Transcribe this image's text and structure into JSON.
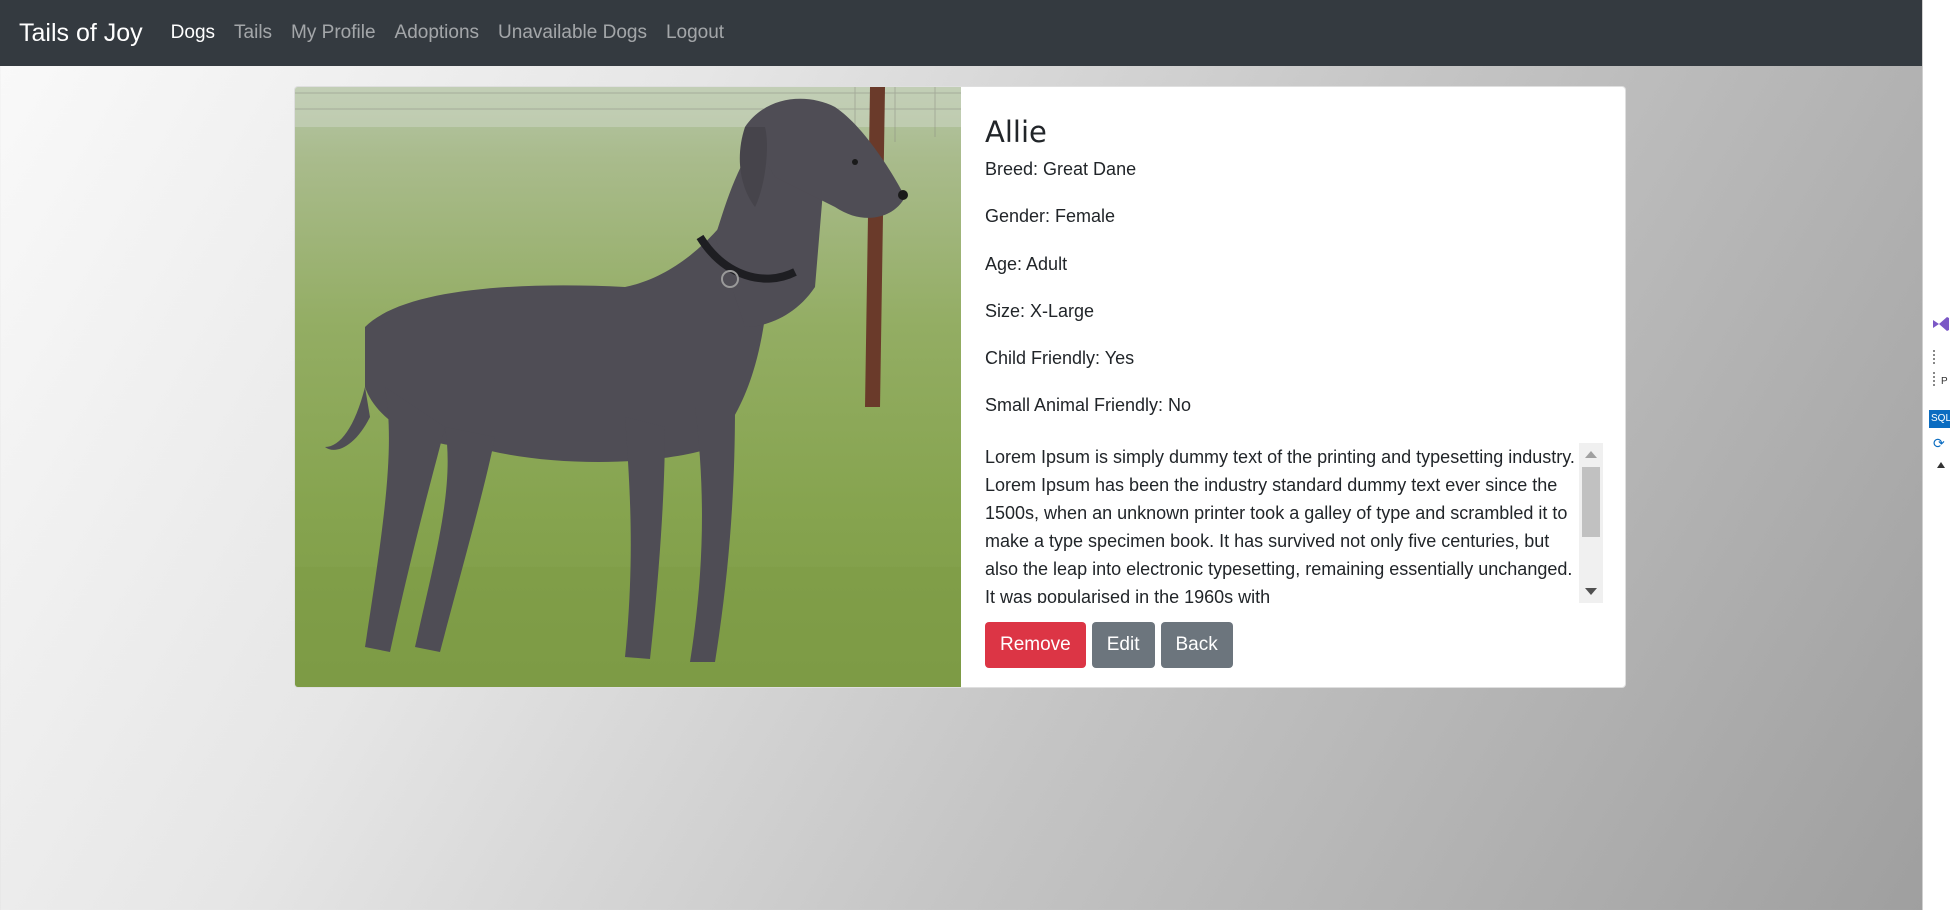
{
  "navbar": {
    "brand": "Tails of Joy",
    "links": [
      "Dogs",
      "Tails",
      "My Profile",
      "Adoptions",
      "Unavailable Dogs",
      "Logout"
    ]
  },
  "dog": {
    "name": "Allie",
    "breed": "Breed: Great Dane",
    "gender": "Gender: Female",
    "age": "Age: Adult",
    "size": "Size: X-Large",
    "child_friendly": "Child Friendly: Yes",
    "small_animal_friendly": "Small Animal Friendly: No",
    "description": "Lorem Ipsum is simply dummy text of the printing and typesetting industry. Lorem Ipsum has been the industry standard dummy text ever since the 1500s, when an unknown printer took a galley of type and scrambled it to make a type specimen book. It has survived not only five centuries, but also the leap into electronic typesetting, remaining essentially unchanged. It was popularised in the 1960s with"
  },
  "buttons": {
    "remove": "Remove",
    "edit": "Edit",
    "back": "Back"
  },
  "side_panel": {
    "sql_tab": "SQL",
    "p_letter": "P"
  },
  "colors": {
    "navbar_bg": "#343a40",
    "danger": "#dc3545",
    "secondary": "#6c757d"
  }
}
